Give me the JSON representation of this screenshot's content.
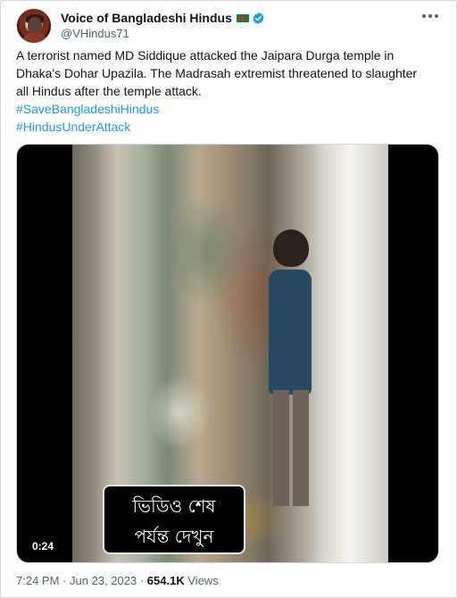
{
  "author": {
    "display_name": "Voice of Bangladeshi Hindus",
    "handle": "@VHindus71"
  },
  "tweet": {
    "text_line1": "A terrorist named MD Siddique attacked the Jaipara Durga temple in",
    "text_line2": "Dhaka's Dohar Upazila. The Madrasah extremist  threatened to slaughter",
    "text_line3": "all Hindus after the temple attack.",
    "hashtags": [
      "#SaveBangladeshiHindus",
      "#HindusUnderAttack"
    ]
  },
  "media": {
    "subtitle_line1": "ভিডিও শেষ",
    "subtitle_line2": "পর্যন্ত দেখুন",
    "duration": "0:24"
  },
  "meta": {
    "time": "7:24 PM",
    "separator1": "·",
    "date": "Jun 23, 2023",
    "separator2": "·",
    "views_count": "654.1K",
    "views_label": "Views"
  },
  "colors": {
    "link": "#1d9bf0",
    "verified": "#1d9bf0",
    "muted": "#536471"
  },
  "icons": {
    "verified": "verified-badge-icon",
    "flag": "bangladesh-flag-icon",
    "more": "more-options-icon"
  }
}
